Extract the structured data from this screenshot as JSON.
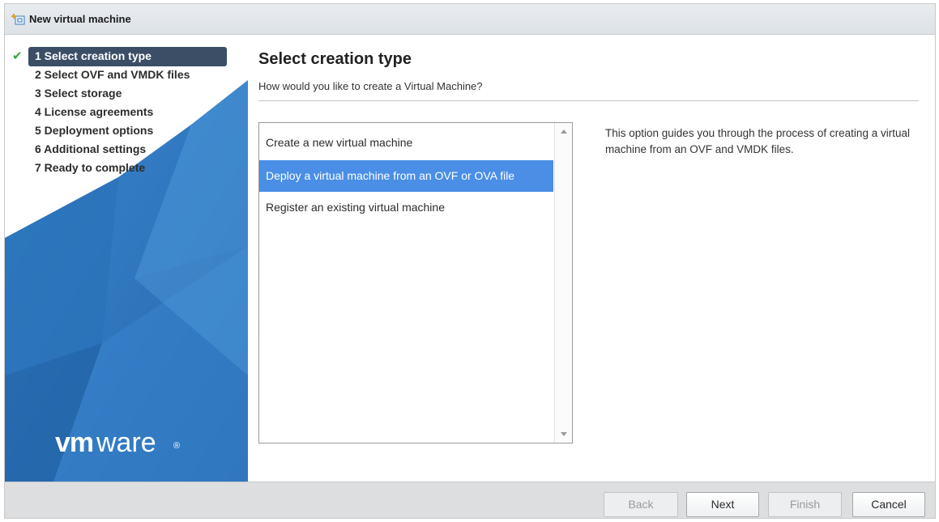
{
  "window": {
    "title": "New virtual machine",
    "icon": "new-vm-icon"
  },
  "sidebar": {
    "steps": [
      {
        "label": "1 Select creation type",
        "completed": true,
        "active": true
      },
      {
        "label": "2 Select OVF and VMDK files",
        "completed": false,
        "active": false
      },
      {
        "label": "3 Select storage",
        "completed": false,
        "active": false
      },
      {
        "label": "4 License agreements",
        "completed": false,
        "active": false
      },
      {
        "label": "5 Deployment options",
        "completed": false,
        "active": false
      },
      {
        "label": "6 Additional settings",
        "completed": false,
        "active": false
      },
      {
        "label": "7 Ready to complete",
        "completed": false,
        "active": false
      }
    ],
    "logo": {
      "bold": "vm",
      "regular": "ware",
      "mark": "®"
    }
  },
  "main": {
    "heading": "Select creation type",
    "subtitle": "How would you like to create a Virtual Machine?",
    "options": [
      {
        "label": "Create a new virtual machine",
        "selected": false
      },
      {
        "label": "Deploy a virtual machine from an OVF or OVA file",
        "selected": true
      },
      {
        "label": "Register an existing virtual machine",
        "selected": false
      }
    ],
    "description": "This option guides you through the process of creating a virtual machine from an OVF and VMDK files."
  },
  "footer": {
    "back_label": "Back",
    "next_label": "Next",
    "finish_label": "Finish",
    "cancel_label": "Cancel"
  },
  "colors": {
    "selection": "#4a8ee6",
    "active_step": "#3b4e66",
    "sidebar_blue": "#2f7ac2",
    "check": "#3aa53a"
  }
}
